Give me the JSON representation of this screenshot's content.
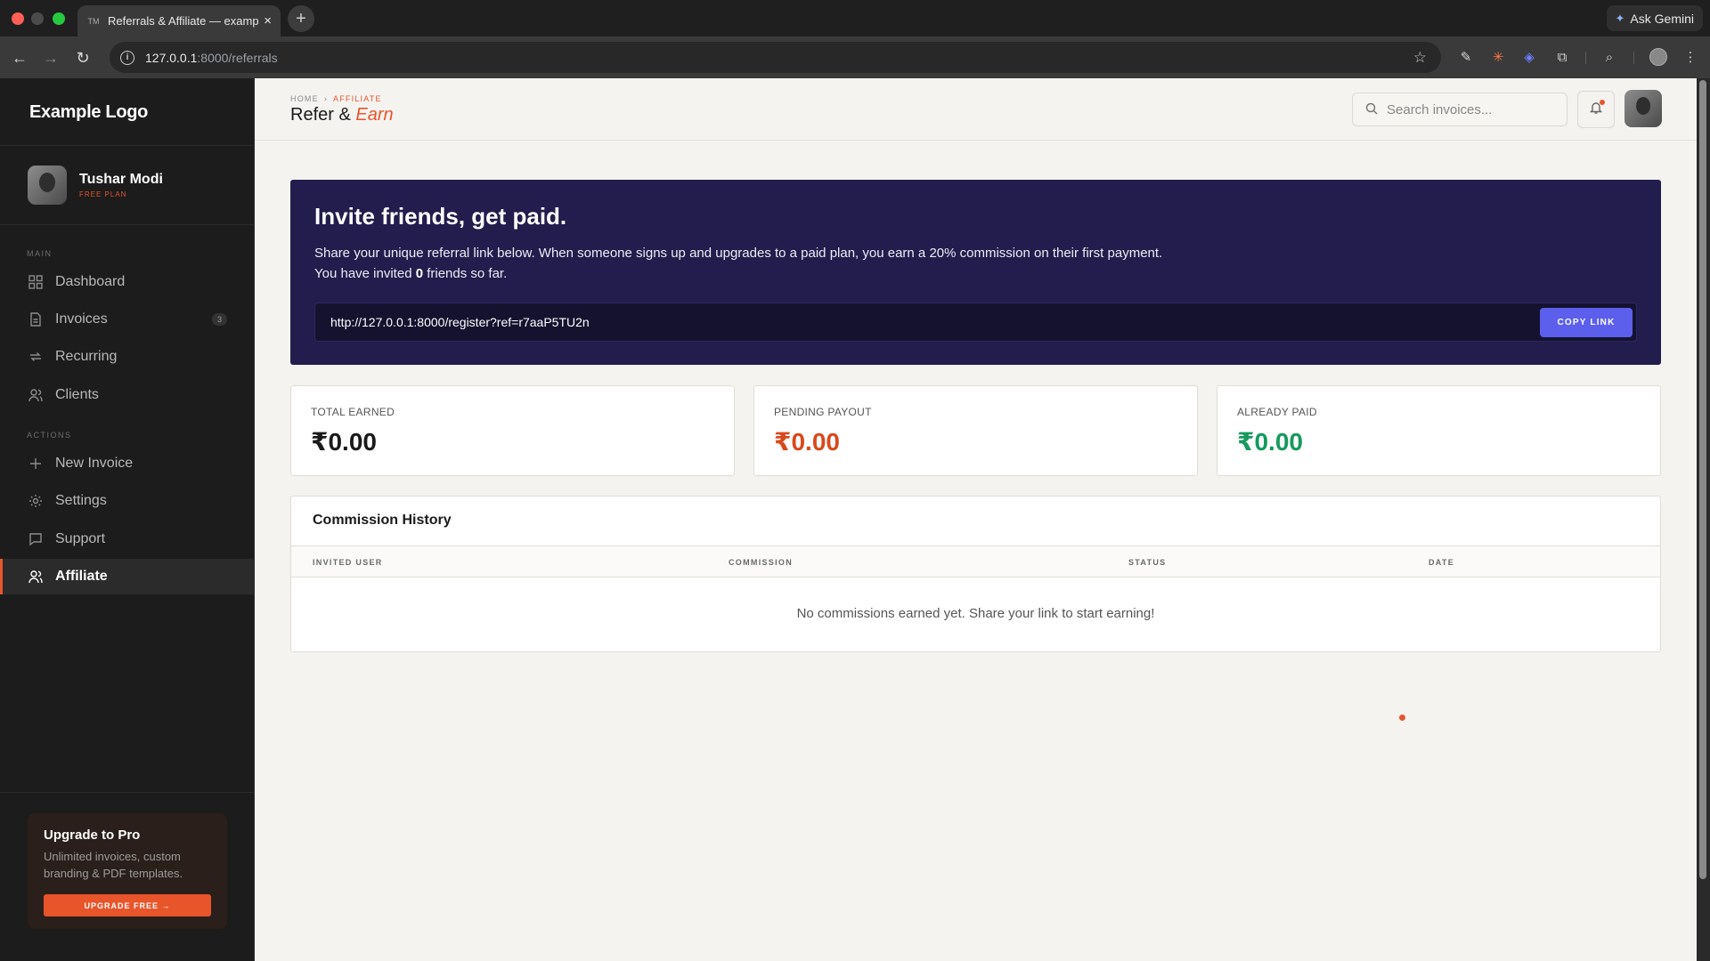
{
  "browser": {
    "tab_title": "Referrals & Affiliate — exampl",
    "tab_favicon": "TM",
    "new_tab": "+",
    "gemini_label": "Ask Gemini",
    "url_host": "127.0.0.1",
    "url_path": ":8000/referrals"
  },
  "sidebar": {
    "logo": "Example Logo",
    "user_name": "Tushar Modi",
    "user_plan": "FREE PLAN",
    "main_label": "MAIN",
    "actions_label": "ACTIONS",
    "items": [
      {
        "label": "Dashboard",
        "icon": "grid-icon"
      },
      {
        "label": "Invoices",
        "icon": "document-icon",
        "badge": "3"
      },
      {
        "label": "Recurring",
        "icon": "repeat-icon"
      },
      {
        "label": "Clients",
        "icon": "users-icon"
      },
      {
        "label": "New Invoice",
        "icon": "plus-icon"
      },
      {
        "label": "Settings",
        "icon": "gear-icon"
      },
      {
        "label": "Support",
        "icon": "chat-icon"
      },
      {
        "label": "Affiliate",
        "icon": "users-icon"
      }
    ],
    "upgrade": {
      "title": "Upgrade to Pro",
      "desc": "Unlimited invoices, custom branding & PDF templates.",
      "button": "UPGRADE FREE →"
    }
  },
  "header": {
    "crumb_home": "HOME",
    "crumb_current": "AFFILIATE",
    "title_plain": "Refer & ",
    "title_em": "Earn",
    "search_placeholder": "Search invoices..."
  },
  "hero": {
    "title": "Invite friends, get paid.",
    "desc": "Share your unique referral link below. When someone signs up and upgrades to a paid plan, you earn a 20% commission on their first payment.",
    "invited_prefix": "You have invited ",
    "invited_count": "0",
    "invited_suffix": " friends so far.",
    "referral_link": "http://127.0.0.1:8000/register?ref=r7aaP5TU2n",
    "copy_button": "COPY LINK"
  },
  "stats": [
    {
      "label": "TOTAL EARNED",
      "value": "₹0.00",
      "color": "#1a1a1a"
    },
    {
      "label": "PENDING PAYOUT",
      "value": "₹0.00",
      "color": "#d9481c"
    },
    {
      "label": "ALREADY PAID",
      "value": "₹0.00",
      "color": "#159a5c"
    }
  ],
  "history": {
    "title": "Commission History",
    "columns": [
      "INVITED USER",
      "COMMISSION",
      "STATUS",
      "DATE"
    ],
    "empty": "No commissions earned yet. Share your link to start earning!"
  },
  "colors": {
    "accent": "#e8552b",
    "hero_bg": "#221d4c",
    "copy_btn": "#5b5fec"
  }
}
